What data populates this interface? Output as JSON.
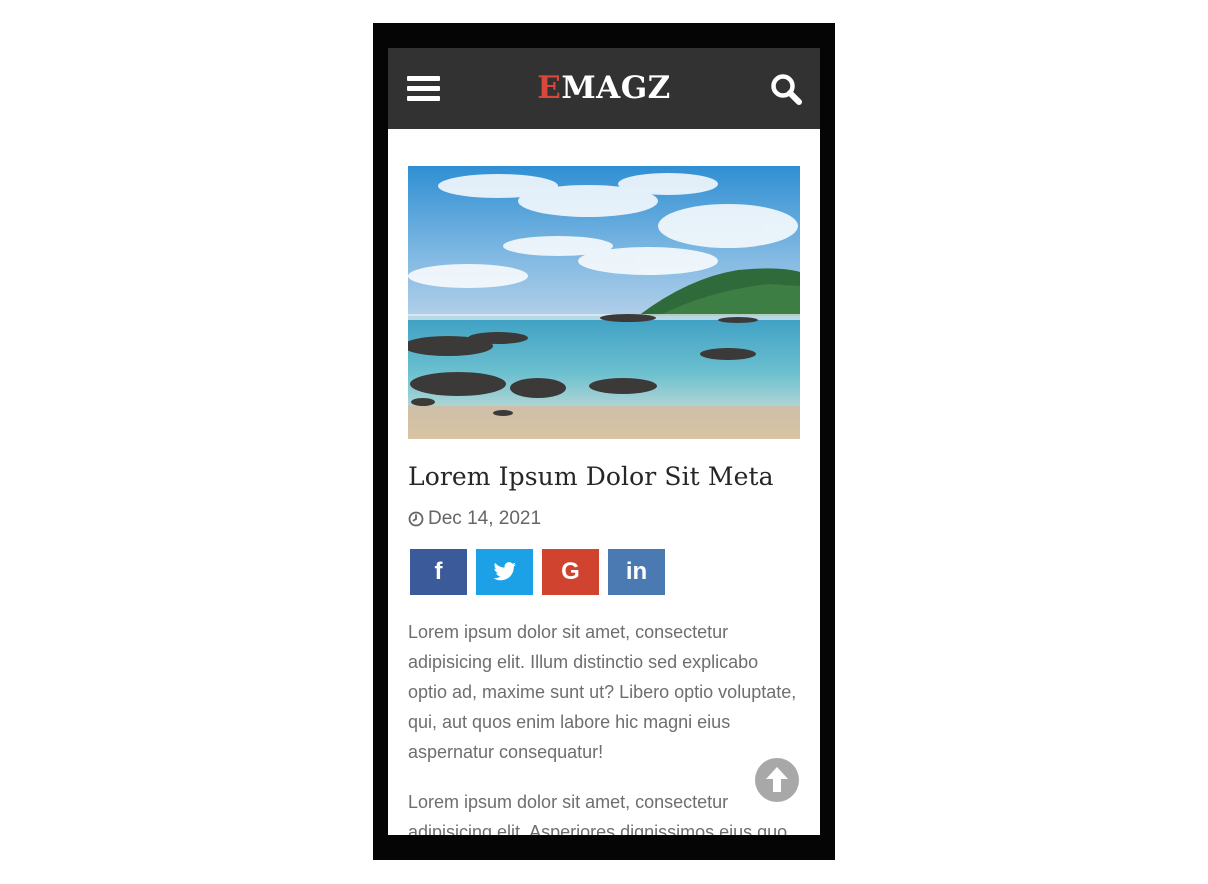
{
  "header": {
    "logo_first_letter": "E",
    "logo_rest": "MAGZ",
    "colors": {
      "navbar_bg": "#323232",
      "logo_accent": "#d9473c"
    },
    "icons": {
      "menu": "hamburger-menu-icon",
      "search": "search-icon"
    }
  },
  "article": {
    "image_alt": "beach-photo",
    "title": "Lorem Ipsum Dolor Sit Meta",
    "date": "Dec 14, 2021",
    "share": [
      {
        "network": "facebook",
        "glyph": "f",
        "color": "#3b5a9a"
      },
      {
        "network": "twitter",
        "glyph": "twitter-bird-icon",
        "color": "#1da1e6"
      },
      {
        "network": "google",
        "glyph": "G",
        "color": "#d0432e"
      },
      {
        "network": "linkedin",
        "glyph": "in",
        "color": "#4b7ab3"
      }
    ],
    "paragraphs": [
      "Lorem ipsum dolor sit amet, consectetur adipisicing elit. Illum distinctio sed explicabo optio ad, maxime sunt ut? Libero optio voluptate, qui, aut quos enim labore hic magni eius aspernatur consequatur!",
      "Lorem ipsum dolor sit amet, consectetur adipisicing elit. Asperiores dignissimos eius quo"
    ]
  },
  "scroll_to_top_icon": "arrow-up-circle-icon"
}
